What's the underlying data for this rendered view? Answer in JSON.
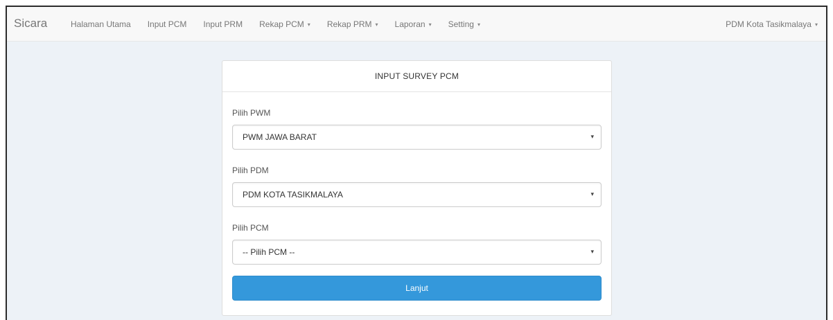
{
  "nav": {
    "brand": "Sicara",
    "items": [
      {
        "label": "Halaman Utama",
        "dropdown": false
      },
      {
        "label": "Input PCM",
        "dropdown": false
      },
      {
        "label": "Input PRM",
        "dropdown": false
      },
      {
        "label": "Rekap PCM",
        "dropdown": true
      },
      {
        "label": "Rekap PRM",
        "dropdown": true
      },
      {
        "label": "Laporan",
        "dropdown": true
      },
      {
        "label": "Setting",
        "dropdown": true
      }
    ],
    "user": "PDM Kota Tasikmalaya",
    "caret_icon": "▾"
  },
  "form": {
    "title": "INPUT SURVEY PCM",
    "fields": [
      {
        "label": "Pilih PWM",
        "value": "PWM JAWA BARAT"
      },
      {
        "label": "Pilih PDM",
        "value": "PDM KOTA TASIKMALAYA"
      },
      {
        "label": "Pilih PCM",
        "value": "-- Pilih PCM --"
      }
    ],
    "submit_label": "Lanjut"
  },
  "colors": {
    "primary_button": "#3498db",
    "page_background": "#edf2f7",
    "navbar_background": "#f8f8f8"
  }
}
